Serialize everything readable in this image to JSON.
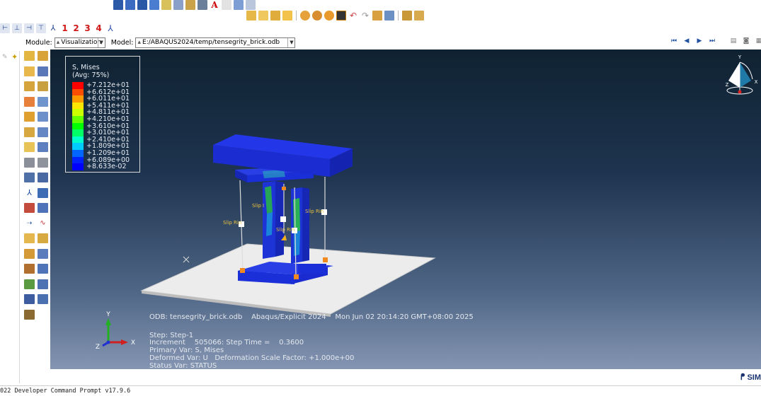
{
  "module_bar": {
    "module_label": "Module:",
    "module_value": "Visualization",
    "model_label": "Model:",
    "model_value": "E:/ABAQUS2024/temp/tensegrity_brick.odb"
  },
  "view_toolbar": {
    "numbers": [
      "1",
      "2",
      "3",
      "4"
    ]
  },
  "legend": {
    "title": "S, Mises",
    "subtitle": "(Avg: 75%)",
    "entries": [
      {
        "label": "+7.212e+01",
        "color": "#ff0000"
      },
      {
        "label": "+6.612e+01",
        "color": "#ff4d00"
      },
      {
        "label": "+6.011e+01",
        "color": "#ff9900"
      },
      {
        "label": "+5.411e+01",
        "color": "#ffe600"
      },
      {
        "label": "+4.811e+01",
        "color": "#ccff00"
      },
      {
        "label": "+4.210e+01",
        "color": "#66ff00"
      },
      {
        "label": "+3.610e+01",
        "color": "#00ff00"
      },
      {
        "label": "+3.010e+01",
        "color": "#00ff66"
      },
      {
        "label": "+2.410e+01",
        "color": "#00ffcc"
      },
      {
        "label": "+1.809e+01",
        "color": "#00ccff"
      },
      {
        "label": "+1.209e+01",
        "color": "#0066ff"
      },
      {
        "label": "+6.089e+00",
        "color": "#0022ff"
      },
      {
        "label": "+8.633e-02",
        "color": "#0000ff"
      }
    ]
  },
  "info": {
    "odb_line": "ODB: tensegrity_brick.odb    Abaqus/Explicit 2024    Mon Jun 02 20:14:20 GMT+08:00 2025",
    "step": "Step: Step-1",
    "increment": "Increment    505066: Step Time =    0.3600",
    "primary": "Primary Var: S, Mises",
    "deformed": "Deformed Var: U   Deformation Scale Factor: +1.000e+00",
    "status": "Status Var: STATUS"
  },
  "scene_labels": {
    "slip_ring": "Slip Rin",
    "slip_ring_short": "Slip I"
  },
  "triad": {
    "x": "X",
    "y": "Y",
    "z": "Z"
  },
  "view_cube": {
    "x": "X",
    "y": "Y",
    "z": "Z"
  },
  "bottom": {
    "command_prompt": "022 Developer Command Prompt v17.9.6",
    "brand": "SIM"
  },
  "colors": {
    "viewport_top": "#0f2232",
    "viewport_bottom": "#8495b2",
    "mesh_blue": "#1b2fd8",
    "floor": "#ececec"
  }
}
